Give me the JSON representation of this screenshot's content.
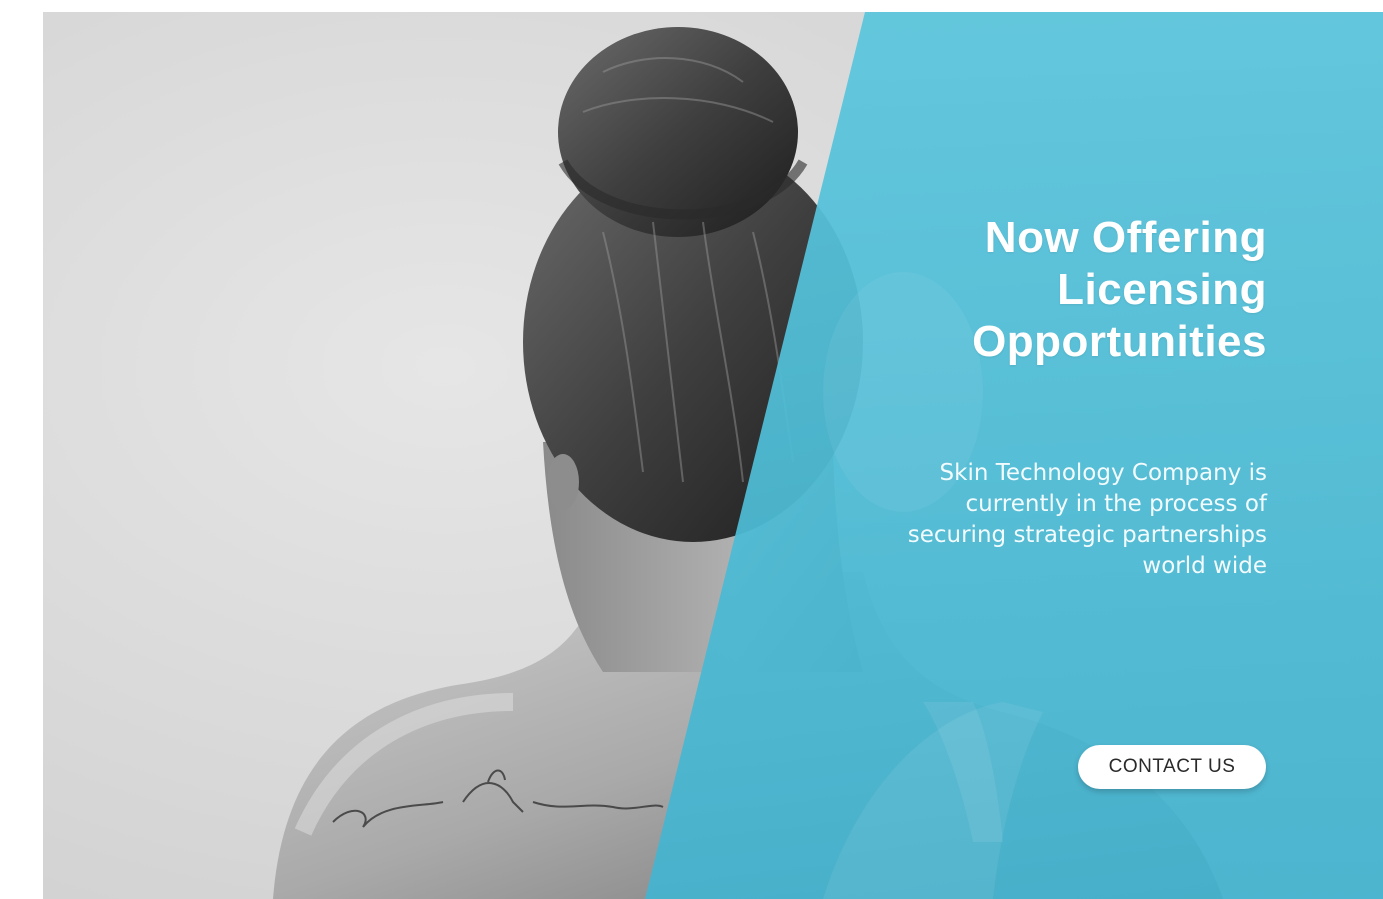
{
  "banner": {
    "headline_lines": [
      "Now Offering",
      "Licensing",
      "Opportunities"
    ],
    "body": "Skin Technology Company is currently in the process of securing strategic partnerships world wide",
    "cta_label": "CONTACT US",
    "colors": {
      "accent": "#4fbdd6",
      "button_bg": "#ffffff",
      "button_text": "#2a2a2a",
      "headline": "#ffffff"
    },
    "image": {
      "subject": "woman-back-photo",
      "style": "black-and-white",
      "tattoo_text": "Together Forever"
    }
  }
}
